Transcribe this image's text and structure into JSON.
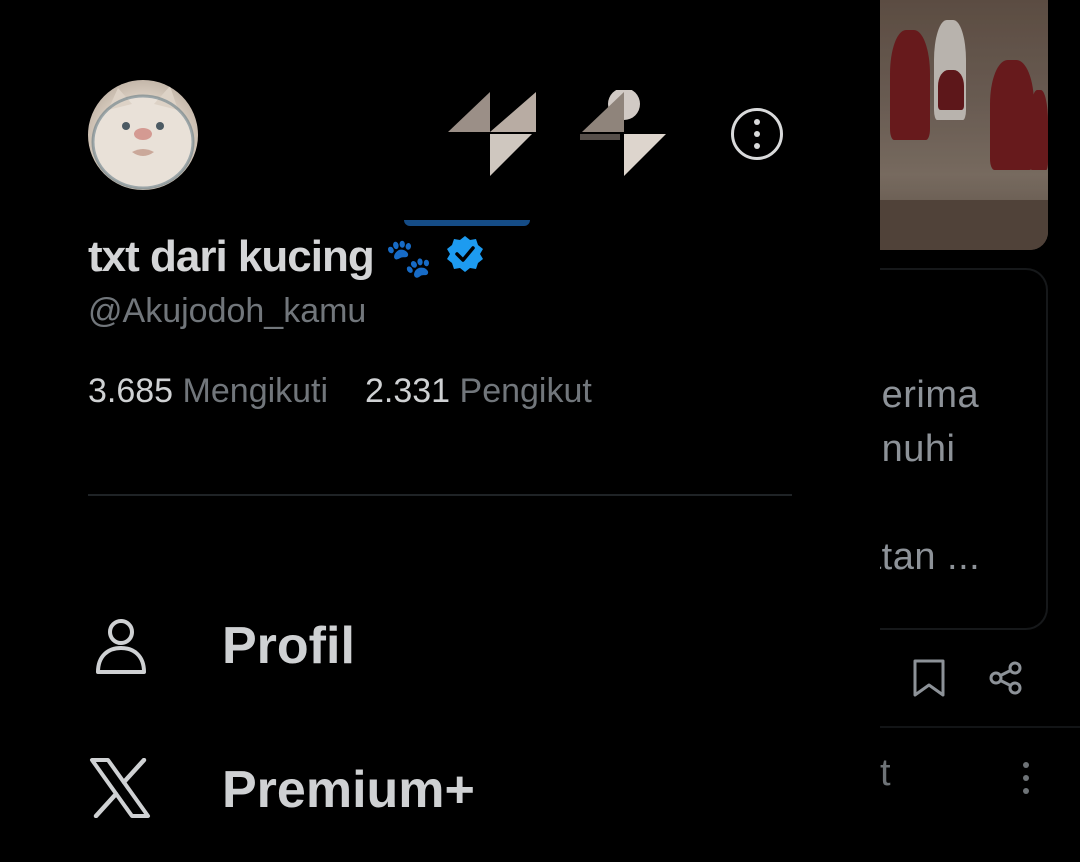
{
  "profile": {
    "display_name": "txt dari kucing",
    "name_emoji": "🐾",
    "handle": "@Akujodoh_kamu",
    "following_count": "3.685",
    "following_label": "Mengikuti",
    "followers_count": "2.331",
    "followers_label": "Pengikut"
  },
  "menu": {
    "items": [
      {
        "label": "Profil",
        "icon": "person-icon"
      },
      {
        "label": "Premium+",
        "icon": "x-logo-icon"
      }
    ]
  },
  "background_feed": {
    "card_lines": [
      "nerima",
      "enuhi",
      ",",
      "atan ..."
    ],
    "partial_text": "t"
  },
  "colors": {
    "background": "#000000",
    "verified_badge": "#1d9bf0",
    "primary_text": "#cfd1d3",
    "secondary_text": "#71767b"
  }
}
